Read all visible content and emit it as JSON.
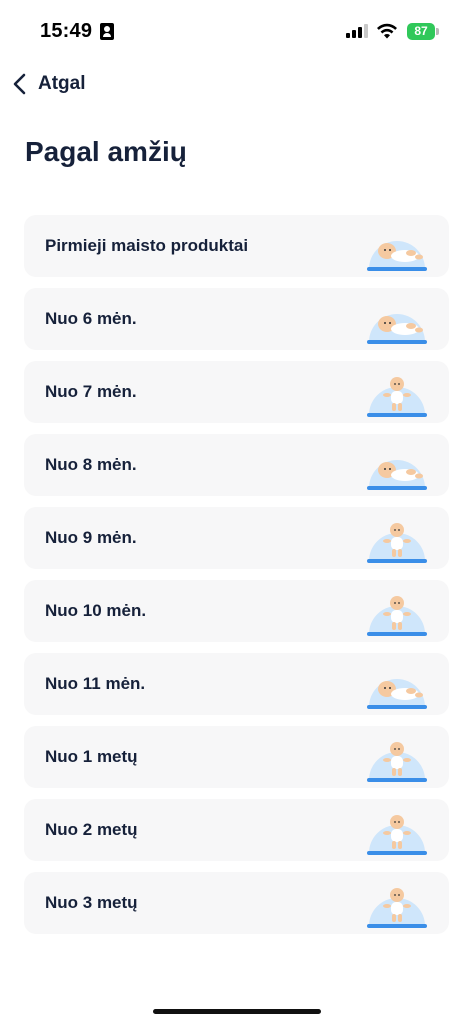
{
  "status_bar": {
    "time": "15:49",
    "battery": "87",
    "icons": [
      "id-card-icon",
      "signal-icon",
      "wifi-icon",
      "battery-icon"
    ]
  },
  "nav": {
    "back_label": "Atgal",
    "back_icon": "chevron-left-icon"
  },
  "page_title": "Pagal amžių",
  "age_groups": [
    {
      "label": "Pirmieji maisto produktai",
      "icon": "baby-lying-icon"
    },
    {
      "label": "Nuo 6 mėn.",
      "icon": "baby-lying-icon"
    },
    {
      "label": "Nuo 7 mėn.",
      "icon": "baby-sitting-icon"
    },
    {
      "label": "Nuo 8 mėn.",
      "icon": "baby-crawling-icon"
    },
    {
      "label": "Nuo 9 mėn.",
      "icon": "baby-sitting-icon"
    },
    {
      "label": "Nuo 10 mėn.",
      "icon": "baby-standing-icon"
    },
    {
      "label": "Nuo 11 mėn.",
      "icon": "baby-crawling-icon"
    },
    {
      "label": "Nuo 1 metų",
      "icon": "toddler-sitting-icon"
    },
    {
      "label": "Nuo 2 metų",
      "icon": "toddler-standing-icon"
    },
    {
      "label": "Nuo 3 metų",
      "icon": "child-standing-icon"
    }
  ],
  "colors": {
    "title": "#16213a",
    "card_background": "#f7f7f8",
    "illustration_blue": "#cfe6fb",
    "illustration_accent": "#3a8ee8",
    "skin": "#f5c9a0",
    "battery_green": "#30c85a"
  }
}
